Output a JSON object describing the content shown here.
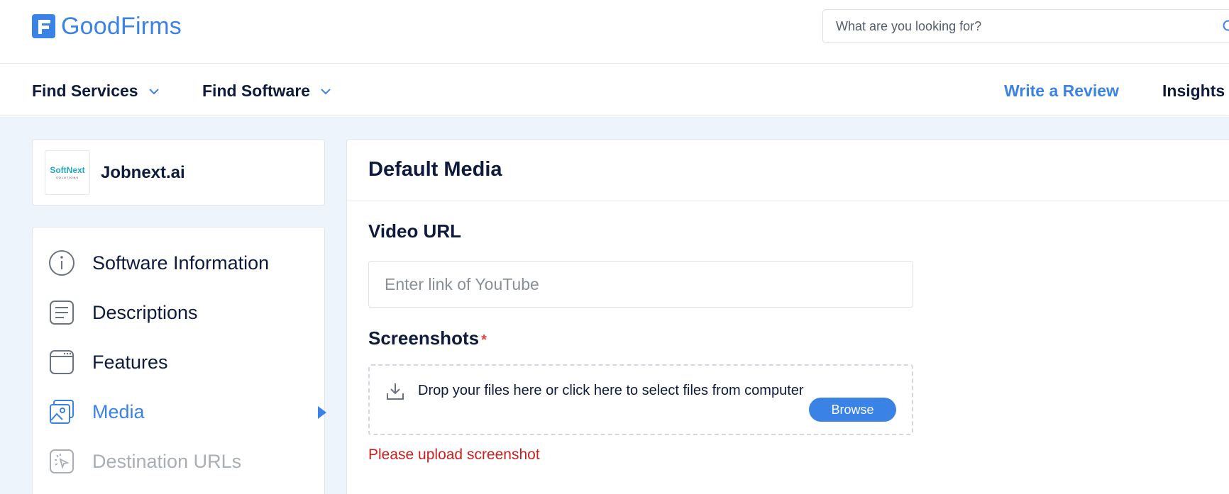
{
  "header": {
    "logo_text": "GoodFirms",
    "search_placeholder": "What are you looking for?"
  },
  "nav": {
    "find_services": "Find Services",
    "find_software": "Find Software",
    "write_review": "Write a Review",
    "insights": "Insights"
  },
  "company": {
    "logo_brand": "SoftNext",
    "logo_sub": "SOLUTIONS",
    "name": "Jobnext.ai"
  },
  "sidebar": {
    "items": [
      {
        "label": "Software Information",
        "icon": "info-icon",
        "state": "normal"
      },
      {
        "label": "Descriptions",
        "icon": "document-icon",
        "state": "normal"
      },
      {
        "label": "Features",
        "icon": "browser-window-icon",
        "state": "normal"
      },
      {
        "label": "Media",
        "icon": "images-icon",
        "state": "active"
      },
      {
        "label": "Destination URLs",
        "icon": "cursor-click-icon",
        "state": "disabled"
      }
    ]
  },
  "main": {
    "title": "Default Media",
    "video_label": "Video URL",
    "video_placeholder": "Enter link of YouTube",
    "screenshots_label": "Screenshots",
    "required_mark": "*",
    "drop_text": "Drop your files here or click here to select files from computer",
    "browse_label": "Browse",
    "error_text": "Please upload screenshot"
  },
  "colors": {
    "accent": "#3b82e6",
    "text_dark": "#0f1b3d",
    "error": "#cc1f1f",
    "page_bg": "#eef4fb"
  }
}
